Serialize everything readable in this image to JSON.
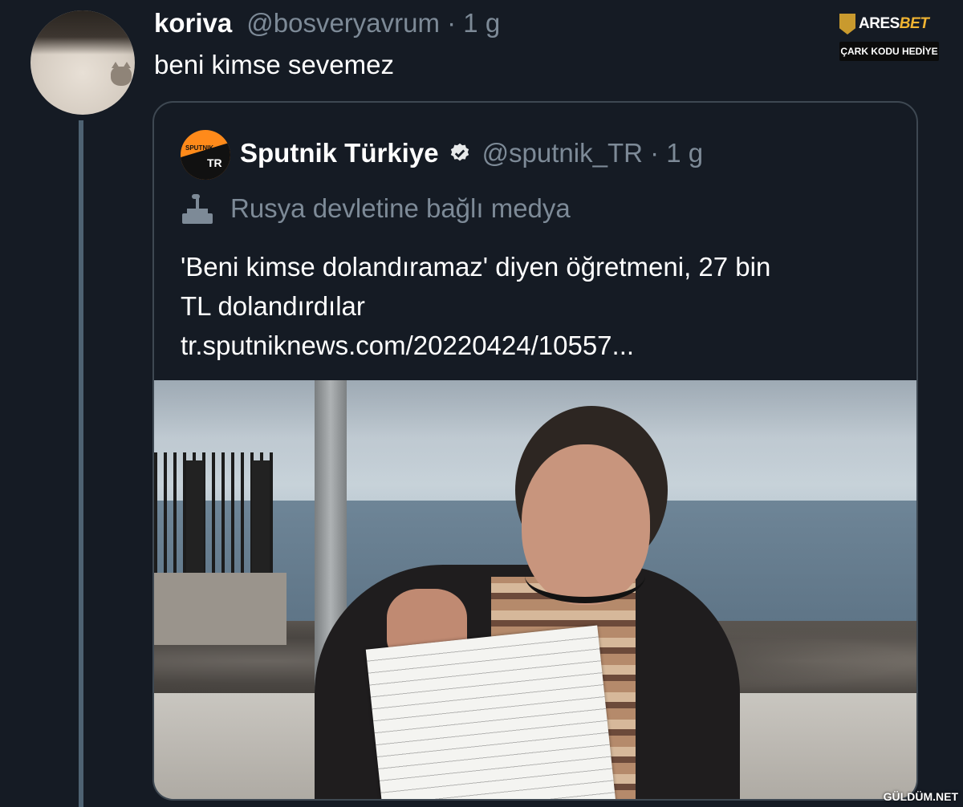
{
  "tweet": {
    "author_name": "koriva",
    "author_handle": "@bosveryavrum · 1 g",
    "text": "beni kimse sevemez"
  },
  "quoted_tweet": {
    "author_name": "Sputnik Türkiye",
    "author_handle": "@sputnik_TR · 1 g",
    "avatar_text": "TR",
    "avatar_small_text": "SPUTNIK",
    "media_label": "Rusya devletine bağlı medya",
    "body_line1": "'Beni kimse dolandıramaz' diyen öğretmeni, 27 bin",
    "body_line2": "TL dolandırdılar",
    "link": "tr.sputniknews.com/20220424/10557..."
  },
  "overlay": {
    "brand_prefix": "ARES",
    "brand_suffix": "BET",
    "brand_badge": "ÇARK KODU HEDİYE",
    "watermark": "GÜLDÜM.NET"
  },
  "colors": {
    "background": "#151b24",
    "secondary_text": "#7d8a97",
    "thread_line": "#4e6272",
    "card_border": "#3e4852",
    "sputnik_orange": "#ff8a1a"
  }
}
